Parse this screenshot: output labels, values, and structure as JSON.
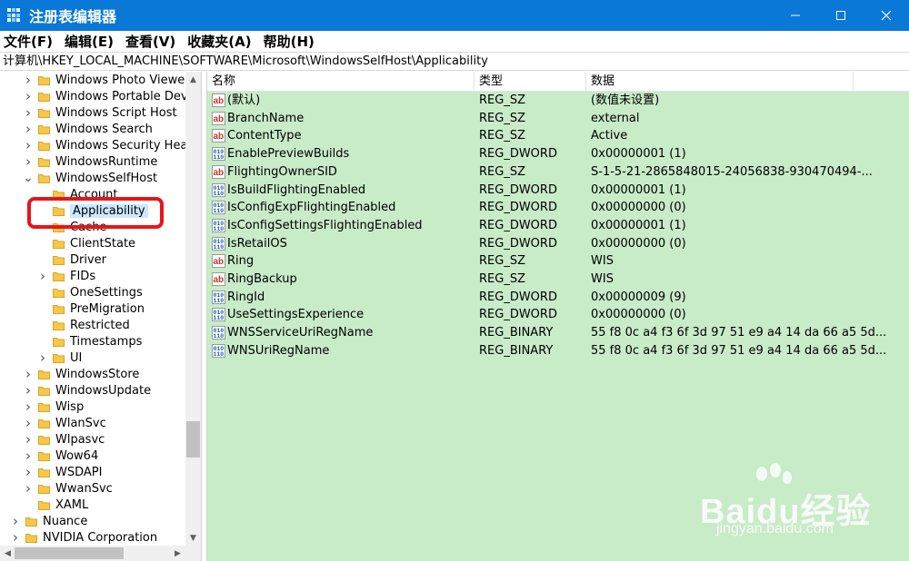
{
  "window": {
    "title": "注册表编辑器",
    "controls": [
      "minimize-icon",
      "maximize-icon",
      "close-icon"
    ]
  },
  "menu": [
    "文件(F)",
    "编辑(E)",
    "查看(V)",
    "收藏夹(A)",
    "帮助(H)"
  ],
  "address": "计算机\\HKEY_LOCAL_MACHINE\\SOFTWARE\\Microsoft\\WindowsSelfHost\\Applicability",
  "tree": [
    {
      "label": "Windows Photo Viewer",
      "expander": "collapsed",
      "level": 1
    },
    {
      "label": "Windows Portable Devic",
      "expander": "collapsed",
      "level": 1
    },
    {
      "label": "Windows Script Host",
      "expander": "collapsed",
      "level": 1
    },
    {
      "label": "Windows Search",
      "expander": "collapsed",
      "level": 1
    },
    {
      "label": "Windows Security Health",
      "expander": "collapsed",
      "level": 1
    },
    {
      "label": "WindowsRuntime",
      "expander": "collapsed",
      "level": 1
    },
    {
      "label": "WindowsSelfHost",
      "expander": "expanded",
      "level": 1
    },
    {
      "label": "Account",
      "expander": "none",
      "level": 2
    },
    {
      "label": "Applicability",
      "expander": "none",
      "level": 2,
      "selected": true
    },
    {
      "label": "Cache",
      "expander": "none",
      "level": 2
    },
    {
      "label": "ClientState",
      "expander": "none",
      "level": 2
    },
    {
      "label": "Driver",
      "expander": "none",
      "level": 2
    },
    {
      "label": "FIDs",
      "expander": "collapsed",
      "level": 2
    },
    {
      "label": "OneSettings",
      "expander": "none",
      "level": 2
    },
    {
      "label": "PreMigration",
      "expander": "none",
      "level": 2
    },
    {
      "label": "Restricted",
      "expander": "none",
      "level": 2
    },
    {
      "label": "Timestamps",
      "expander": "none",
      "level": 2
    },
    {
      "label": "UI",
      "expander": "collapsed",
      "level": 2
    },
    {
      "label": "WindowsStore",
      "expander": "collapsed",
      "level": 1
    },
    {
      "label": "WindowsUpdate",
      "expander": "collapsed",
      "level": 1
    },
    {
      "label": "Wisp",
      "expander": "collapsed",
      "level": 1
    },
    {
      "label": "WlanSvc",
      "expander": "collapsed",
      "level": 1
    },
    {
      "label": "Wlpasvc",
      "expander": "collapsed",
      "level": 1
    },
    {
      "label": "Wow64",
      "expander": "collapsed",
      "level": 1
    },
    {
      "label": "WSDAPI",
      "expander": "collapsed",
      "level": 1
    },
    {
      "label": "WwanSvc",
      "expander": "collapsed",
      "level": 1
    },
    {
      "label": "XAML",
      "expander": "none",
      "level": 1
    },
    {
      "label": "Nuance",
      "expander": "collapsed",
      "level": 0
    },
    {
      "label": "NVIDIA Corporation",
      "expander": "collapsed",
      "level": 0
    }
  ],
  "columns": [
    "名称",
    "类型",
    "数据"
  ],
  "values": [
    {
      "name": "(默认)",
      "type": "REG_SZ",
      "data": "(数值未设置)",
      "icon": "string-value-icon"
    },
    {
      "name": "BranchName",
      "type": "REG_SZ",
      "data": "external",
      "icon": "string-value-icon"
    },
    {
      "name": "ContentType",
      "type": "REG_SZ",
      "data": "Active",
      "icon": "string-value-icon"
    },
    {
      "name": "EnablePreviewBuilds",
      "type": "REG_DWORD",
      "data": "0x00000001 (1)",
      "icon": "binary-value-icon"
    },
    {
      "name": "FlightingOwnerSID",
      "type": "REG_SZ",
      "data": "S-1-5-21-2865848015-24056838-930470494-...",
      "icon": "string-value-icon"
    },
    {
      "name": "IsBuildFlightingEnabled",
      "type": "REG_DWORD",
      "data": "0x00000001 (1)",
      "icon": "binary-value-icon"
    },
    {
      "name": "IsConfigExpFlightingEnabled",
      "type": "REG_DWORD",
      "data": "0x00000000 (0)",
      "icon": "binary-value-icon"
    },
    {
      "name": "IsConfigSettingsFlightingEnabled",
      "type": "REG_DWORD",
      "data": "0x00000001 (1)",
      "icon": "binary-value-icon"
    },
    {
      "name": "IsRetailOS",
      "type": "REG_DWORD",
      "data": "0x00000000 (0)",
      "icon": "binary-value-icon"
    },
    {
      "name": "Ring",
      "type": "REG_SZ",
      "data": "WIS",
      "icon": "string-value-icon"
    },
    {
      "name": "RingBackup",
      "type": "REG_SZ",
      "data": "WIS",
      "icon": "string-value-icon"
    },
    {
      "name": "RingId",
      "type": "REG_DWORD",
      "data": "0x00000009 (9)",
      "icon": "binary-value-icon"
    },
    {
      "name": "UseSettingsExperience",
      "type": "REG_DWORD",
      "data": "0x00000000 (0)",
      "icon": "binary-value-icon"
    },
    {
      "name": "WNSServiceUriRegName",
      "type": "REG_BINARY",
      "data": "55 f8 0c a4 f3 6f 3d 97 51 e9 a4 14 da 66 a5 5d...",
      "icon": "binary-value-icon"
    },
    {
      "name": "WNSUriRegName",
      "type": "REG_BINARY",
      "data": "55 f8 0c a4 f3 6f 3d 97 51 e9 a4 14 da 66 a5 5d...",
      "icon": "binary-value-icon"
    }
  ],
  "watermark": {
    "brand": "Baidu经验",
    "url": "jingyan.baidu.com"
  },
  "colors": {
    "titlebar": "#0a78d7",
    "list_bg": "#c8ebc8",
    "highlight": "#e8141b",
    "selection": "#cce8ff"
  }
}
